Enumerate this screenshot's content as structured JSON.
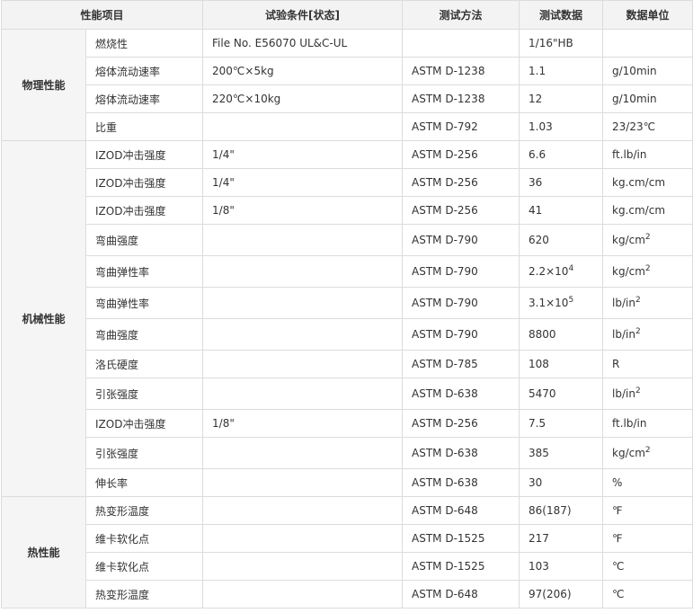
{
  "headers": [
    "性能项目",
    "试验条件[状态]",
    "测试方法",
    "测试数据",
    "数据单位"
  ],
  "groups": [
    {
      "name": "物理性能",
      "rows": [
        {
          "item": "燃烧性",
          "cond": "File No. E56070 UL&C-UL",
          "method": "",
          "value": "1/16\"HB",
          "unit": ""
        },
        {
          "item": "熔体流动速率",
          "cond": "200℃×5kg",
          "method": "ASTM D-1238",
          "value": "1.1",
          "unit": "g/10min"
        },
        {
          "item": "熔体流动速率",
          "cond": "220℃×10kg",
          "method": "ASTM D-1238",
          "value": "12",
          "unit": "g/10min"
        },
        {
          "item": "比重",
          "cond": "",
          "method": "ASTM D-792",
          "value": "1.03",
          "unit": "23/23℃"
        }
      ]
    },
    {
      "name": "机械性能",
      "rows": [
        {
          "item": "IZOD冲击强度",
          "cond": "1/4\"",
          "method": "ASTM D-256",
          "value": "6.6",
          "unit": "ft.lb/in"
        },
        {
          "item": "IZOD冲击强度",
          "cond": "1/4\"",
          "method": "ASTM D-256",
          "value": "36",
          "unit": "kg.cm/cm"
        },
        {
          "item": "IZOD冲击强度",
          "cond": "1/8\"",
          "method": "ASTM D-256",
          "value": "41",
          "unit": "kg.cm/cm"
        },
        {
          "item": "弯曲强度",
          "cond": "",
          "method": "ASTM D-790",
          "value": "620",
          "unit": "kg/cm",
          "unit_sup": "2"
        },
        {
          "item": "弯曲弹性率",
          "cond": "",
          "method": "ASTM D-790",
          "value": "2.2×10",
          "value_sup": "4",
          "unit": "kg/cm",
          "unit_sup": "2"
        },
        {
          "item": "弯曲弹性率",
          "cond": "",
          "method": "ASTM D-790",
          "value": "3.1×10",
          "value_sup": "5",
          "unit": "lb/in",
          "unit_sup": "2"
        },
        {
          "item": "弯曲强度",
          "cond": "",
          "method": "ASTM D-790",
          "value": "8800",
          "unit": "lb/in",
          "unit_sup": "2"
        },
        {
          "item": "洛氏硬度",
          "cond": "",
          "method": "ASTM D-785",
          "value": "108",
          "unit": "R"
        },
        {
          "item": "引张强度",
          "cond": "",
          "method": "ASTM D-638",
          "value": "5470",
          "unit": "lb/in",
          "unit_sup": "2"
        },
        {
          "item": "IZOD冲击强度",
          "cond": "1/8\"",
          "method": "ASTM D-256",
          "value": "7.5",
          "unit": "ft.lb/in"
        },
        {
          "item": "引张强度",
          "cond": "",
          "method": "ASTM D-638",
          "value": "385",
          "unit": "kg/cm",
          "unit_sup": "2"
        },
        {
          "item": "伸长率",
          "cond": "",
          "method": "ASTM D-638",
          "value": "30",
          "unit": "%"
        }
      ]
    },
    {
      "name": "热性能",
      "rows": [
        {
          "item": "热变形温度",
          "cond": "",
          "method": "ASTM D-648",
          "value": "86(187)",
          "unit": "℉"
        },
        {
          "item": "维卡软化点",
          "cond": "",
          "method": "ASTM D-1525",
          "value": "217",
          "unit": "℉"
        },
        {
          "item": "维卡软化点",
          "cond": "",
          "method": "ASTM D-1525",
          "value": "103",
          "unit": "℃"
        },
        {
          "item": "热变形温度",
          "cond": "",
          "method": "ASTM D-648",
          "value": "97(206)",
          "unit": "℃"
        }
      ]
    }
  ]
}
